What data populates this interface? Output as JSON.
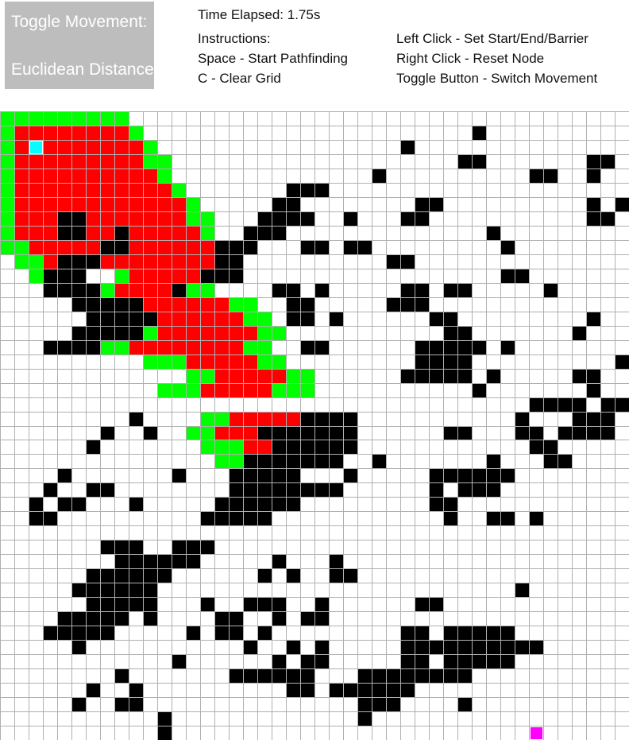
{
  "toggle": {
    "title": "Toggle Movement:",
    "mode": "Euclidean Distance"
  },
  "status": {
    "time_elapsed": "Time Elapsed: 1.75s"
  },
  "instructions": {
    "heading": "Instructions:",
    "items": [
      "Space - Start Pathfinding",
      "C - Clear Grid",
      "Left Click - Set Start/End/Barrier",
      "Right Click - Reset Node",
      "Toggle Button - Switch Movement"
    ]
  },
  "colors": {
    "barrier": "#000000",
    "closed": "#ff0000",
    "open": "#00ff00",
    "start": "#00ffff",
    "end": "#ff00ff",
    "grid_line": "#b0b0b0",
    "empty": "#ffffff"
  },
  "grid": {
    "rows": 44,
    "cols": 44,
    "cells": [
      "GGGGGGGGG...................................",
      "GRRRRRRRRG.......................B..........",
      "GRSRRRRRRRG.................B..............",
      "GRRRRRRRRRGG....................BB.......BB.",
      "GRRRRRRRRRRG..............B..........BB..B.",
      "GRRRRRRRRRRRG.......BBB.......................",
      "GRRRRRRRRRRRRG.....BB........BB..........B.B.",
      "GRRRBBRRRRRRRGG...BBBB..B...BB...........BB..",
      "GRRRBBRRBRRRRRG..BBB..............B.........",
      "GGRRRRRBBRRRRRRBBB...BB.BB.........B........",
      ".GGRBBBRRRRRRRRBB..........BB.............",
      "..GBBB..GRRRRRBBB..................BB.......",
      "...BBBBGRRRRBGG....BB.B.....BB.BB.....B....",
      ".....BBBBBRRRRRRGG..BB.....BBB..............",
      "......BBBBBRRRRRRGG.BB.B......BB.........B..",
      ".....BBBBBGRRRRRRRGG...........BB.......B...",
      "...BBBBGGRRRRRRRRGG..BB......BBBBB.B......",
      "..........GGGRRRRRGG.........BBBB..........BB",
      ".............GGRRRRRGG......BBBBB.B.....BB...",
      "...........GGGRRRRRGGG...........B.......B...",
      ".....................................BBBB.BB..",
      ".........B....GGRRRRRBBBB...........B...BBB.",
      ".......B..B..GGRRRBBBBBBB......BB...BB.BBBB",
      "......B.......GGGRRBBBBBB............BB.",
      "...............GGBBBBBBB..B.......B...BB..",
      "....B.......B...BBBBB...B.....BBBBBB.....",
      "...B..BB........BBBBBBBB......B.BBB......",
      "..B.BB...B.....BBBBBB.........BB......",
      "..BB..........BBBBB............B..BB.B.",
      ".......................................",
      ".......BBB..BBB.........................",
      "........BBBBBB.....B...B..................",
      "......BBBBBB......B.B..BB.................",
      ".....BBBBBB.........................B......",
      "......BBBBB...B..BBB..B......BB.........",
      "....BBBBB.B....BB..B.BB..............",
      "...BBBBB.....B.BB.B.........BB.BBBBB...",
      ".....B...........B..B.B.....BBBBBBBBBB",
      "............B......B.BB.....BB.BBBBB.",
      "........B.......BBBBBB...BBBBBBBB....",
      "......B..B..........BB.BBBBBB......",
      ".....B..BB...............BBB....B..",
      "...........B.............B.......",
      "...........B.........................E."
    ]
  }
}
